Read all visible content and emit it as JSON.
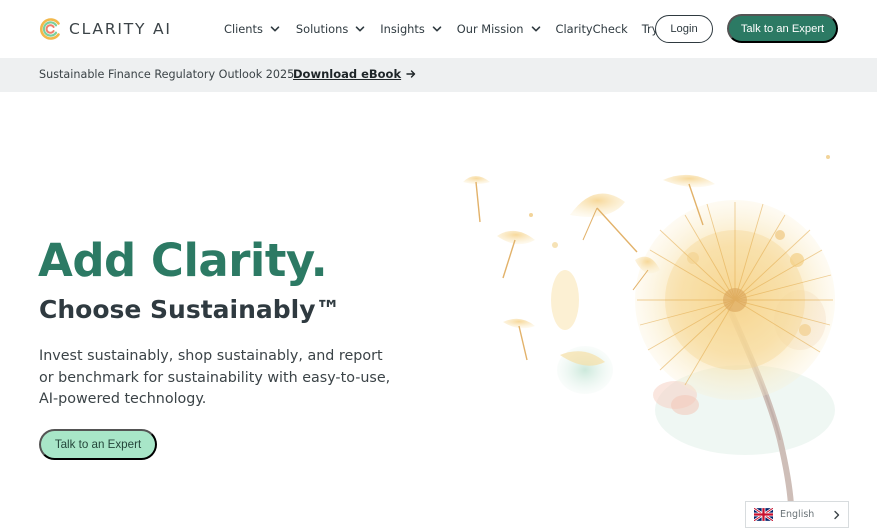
{
  "brand": {
    "name": "CLARITY AI",
    "color_primary": "#2c7a64",
    "color_accent_light": "#a8e6c8"
  },
  "nav": {
    "items": [
      {
        "label": "Clients",
        "has_dropdown": true
      },
      {
        "label": "Solutions",
        "has_dropdown": true
      },
      {
        "label": "Insights",
        "has_dropdown": true
      },
      {
        "label": "Our Mission",
        "has_dropdown": true
      },
      {
        "label": "ClarityCheck",
        "has_dropdown": false
      },
      {
        "label": "Try GenAI",
        "has_dropdown": false
      }
    ],
    "login_label": "Login",
    "cta_label": "Talk to an Expert"
  },
  "banner": {
    "text": "Sustainable Finance Regulatory Outlook 2025",
    "link_label": "Download eBook",
    "link_icon": "arrow-right-icon"
  },
  "hero": {
    "title": "Add Clarity.",
    "subtitle": "Choose Sustainably™",
    "description": "Invest sustainably, shop sustainably, and report or benchmark for sustainability with easy-to-use, AI-powered technology.",
    "cta_label": "Talk to an Expert",
    "illustration_icon": "dandelion-illustration"
  },
  "language_selector": {
    "label": "English",
    "flag_icon": "uk-flag-icon",
    "chevron_icon": "chevron-right-icon"
  }
}
